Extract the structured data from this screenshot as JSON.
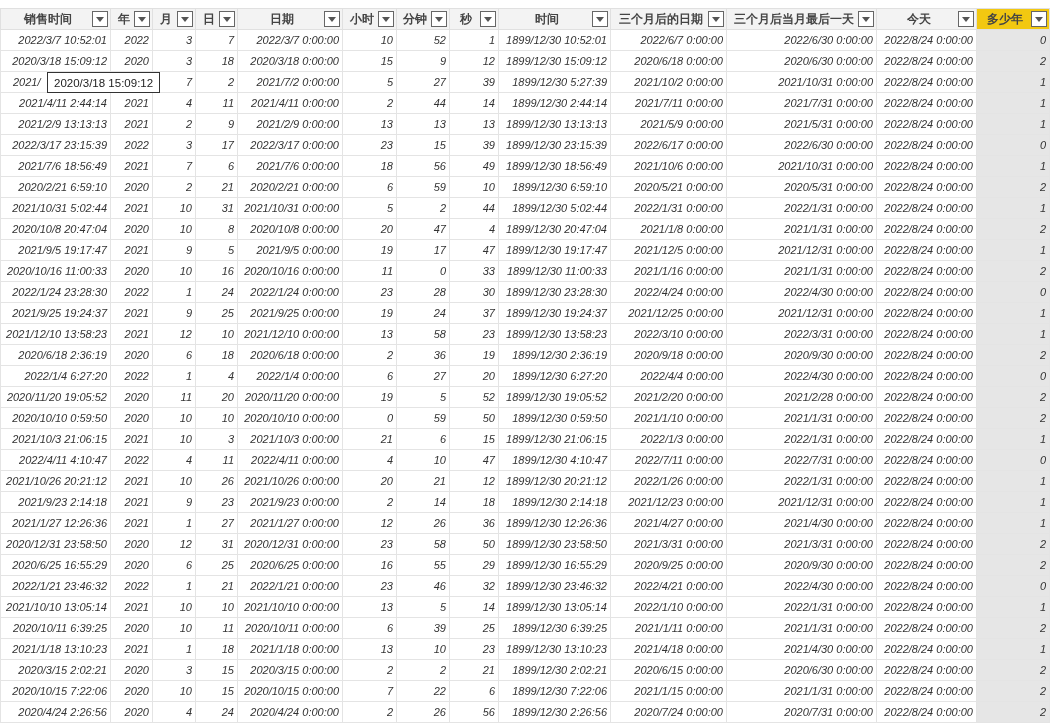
{
  "table": {
    "columns": [
      {
        "label": "销售时间",
        "selected": false
      },
      {
        "label": "年",
        "selected": false
      },
      {
        "label": "月",
        "selected": false
      },
      {
        "label": "日",
        "selected": false
      },
      {
        "label": "日期",
        "selected": false
      },
      {
        "label": "小时",
        "selected": false
      },
      {
        "label": "分钟",
        "selected": false
      },
      {
        "label": "秒",
        "selected": false
      },
      {
        "label": "时间",
        "selected": false
      },
      {
        "label": "三个月后的日期",
        "selected": false
      },
      {
        "label": "三个月后当月最后一天",
        "selected": false
      },
      {
        "label": "今天",
        "selected": false
      },
      {
        "label": "多少年",
        "selected": true
      }
    ],
    "rows": [
      [
        "2022/3/7 10:52:01",
        "2022",
        "3",
        "7",
        "2022/3/7 0:00:00",
        "10",
        "52",
        "1",
        "1899/12/30 10:52:01",
        "2022/6/7 0:00:00",
        "2022/6/30 0:00:00",
        "2022/8/24 0:00:00",
        "0"
      ],
      [
        "2020/3/18 15:09:12",
        "2020",
        "3",
        "18",
        "2020/3/18 0:00:00",
        "15",
        "9",
        "12",
        "1899/12/30 15:09:12",
        "2020/6/18 0:00:00",
        "2020/6/30 0:00:00",
        "2022/8/24 0:00:00",
        "2"
      ],
      {
        "cells": [
          "2021/",
          null,
          "7",
          "2",
          "2021/7/2 0:00:00",
          "5",
          "27",
          "39",
          "1899/12/30 5:27:39",
          "2021/10/2 0:00:00",
          "2021/10/31 0:00:00",
          "2022/8/24 0:00:00",
          "1"
        ],
        "tooltip": "2020/3/18 15:09:12"
      },
      [
        "2021/4/11 2:44:14",
        "2021",
        "4",
        "11",
        "2021/4/11 0:00:00",
        "2",
        "44",
        "14",
        "1899/12/30 2:44:14",
        "2021/7/11 0:00:00",
        "2021/7/31 0:00:00",
        "2022/8/24 0:00:00",
        "1"
      ],
      [
        "2021/2/9 13:13:13",
        "2021",
        "2",
        "9",
        "2021/2/9 0:00:00",
        "13",
        "13",
        "13",
        "1899/12/30 13:13:13",
        "2021/5/9 0:00:00",
        "2021/5/31 0:00:00",
        "2022/8/24 0:00:00",
        "1"
      ],
      [
        "2022/3/17 23:15:39",
        "2022",
        "3",
        "17",
        "2022/3/17 0:00:00",
        "23",
        "15",
        "39",
        "1899/12/30 23:15:39",
        "2022/6/17 0:00:00",
        "2022/6/30 0:00:00",
        "2022/8/24 0:00:00",
        "0"
      ],
      [
        "2021/7/6 18:56:49",
        "2021",
        "7",
        "6",
        "2021/7/6 0:00:00",
        "18",
        "56",
        "49",
        "1899/12/30 18:56:49",
        "2021/10/6 0:00:00",
        "2021/10/31 0:00:00",
        "2022/8/24 0:00:00",
        "1"
      ],
      [
        "2020/2/21 6:59:10",
        "2020",
        "2",
        "21",
        "2020/2/21 0:00:00",
        "6",
        "59",
        "10",
        "1899/12/30 6:59:10",
        "2020/5/21 0:00:00",
        "2020/5/31 0:00:00",
        "2022/8/24 0:00:00",
        "2"
      ],
      [
        "2021/10/31 5:02:44",
        "2021",
        "10",
        "31",
        "2021/10/31 0:00:00",
        "5",
        "2",
        "44",
        "1899/12/30 5:02:44",
        "2022/1/31 0:00:00",
        "2022/1/31 0:00:00",
        "2022/8/24 0:00:00",
        "1"
      ],
      [
        "2020/10/8 20:47:04",
        "2020",
        "10",
        "8",
        "2020/10/8 0:00:00",
        "20",
        "47",
        "4",
        "1899/12/30 20:47:04",
        "2021/1/8 0:00:00",
        "2021/1/31 0:00:00",
        "2022/8/24 0:00:00",
        "2"
      ],
      [
        "2021/9/5 19:17:47",
        "2021",
        "9",
        "5",
        "2021/9/5 0:00:00",
        "19",
        "17",
        "47",
        "1899/12/30 19:17:47",
        "2021/12/5 0:00:00",
        "2021/12/31 0:00:00",
        "2022/8/24 0:00:00",
        "1"
      ],
      [
        "2020/10/16 11:00:33",
        "2020",
        "10",
        "16",
        "2020/10/16 0:00:00",
        "11",
        "0",
        "33",
        "1899/12/30 11:00:33",
        "2021/1/16 0:00:00",
        "2021/1/31 0:00:00",
        "2022/8/24 0:00:00",
        "2"
      ],
      [
        "2022/1/24 23:28:30",
        "2022",
        "1",
        "24",
        "2022/1/24 0:00:00",
        "23",
        "28",
        "30",
        "1899/12/30 23:28:30",
        "2022/4/24 0:00:00",
        "2022/4/30 0:00:00",
        "2022/8/24 0:00:00",
        "0"
      ],
      [
        "2021/9/25 19:24:37",
        "2021",
        "9",
        "25",
        "2021/9/25 0:00:00",
        "19",
        "24",
        "37",
        "1899/12/30 19:24:37",
        "2021/12/25 0:00:00",
        "2021/12/31 0:00:00",
        "2022/8/24 0:00:00",
        "1"
      ],
      [
        "2021/12/10 13:58:23",
        "2021",
        "12",
        "10",
        "2021/12/10 0:00:00",
        "13",
        "58",
        "23",
        "1899/12/30 13:58:23",
        "2022/3/10 0:00:00",
        "2022/3/31 0:00:00",
        "2022/8/24 0:00:00",
        "1"
      ],
      [
        "2020/6/18 2:36:19",
        "2020",
        "6",
        "18",
        "2020/6/18 0:00:00",
        "2",
        "36",
        "19",
        "1899/12/30 2:36:19",
        "2020/9/18 0:00:00",
        "2020/9/30 0:00:00",
        "2022/8/24 0:00:00",
        "2"
      ],
      [
        "2022/1/4 6:27:20",
        "2022",
        "1",
        "4",
        "2022/1/4 0:00:00",
        "6",
        "27",
        "20",
        "1899/12/30 6:27:20",
        "2022/4/4 0:00:00",
        "2022/4/30 0:00:00",
        "2022/8/24 0:00:00",
        "0"
      ],
      [
        "2020/11/20 19:05:52",
        "2020",
        "11",
        "20",
        "2020/11/20 0:00:00",
        "19",
        "5",
        "52",
        "1899/12/30 19:05:52",
        "2021/2/20 0:00:00",
        "2021/2/28 0:00:00",
        "2022/8/24 0:00:00",
        "2"
      ],
      [
        "2020/10/10 0:59:50",
        "2020",
        "10",
        "10",
        "2020/10/10 0:00:00",
        "0",
        "59",
        "50",
        "1899/12/30 0:59:50",
        "2021/1/10 0:00:00",
        "2021/1/31 0:00:00",
        "2022/8/24 0:00:00",
        "2"
      ],
      [
        "2021/10/3 21:06:15",
        "2021",
        "10",
        "3",
        "2021/10/3 0:00:00",
        "21",
        "6",
        "15",
        "1899/12/30 21:06:15",
        "2022/1/3 0:00:00",
        "2022/1/31 0:00:00",
        "2022/8/24 0:00:00",
        "1"
      ],
      [
        "2022/4/11 4:10:47",
        "2022",
        "4",
        "11",
        "2022/4/11 0:00:00",
        "4",
        "10",
        "47",
        "1899/12/30 4:10:47",
        "2022/7/11 0:00:00",
        "2022/7/31 0:00:00",
        "2022/8/24 0:00:00",
        "0"
      ],
      [
        "2021/10/26 20:21:12",
        "2021",
        "10",
        "26",
        "2021/10/26 0:00:00",
        "20",
        "21",
        "12",
        "1899/12/30 20:21:12",
        "2022/1/26 0:00:00",
        "2022/1/31 0:00:00",
        "2022/8/24 0:00:00",
        "1"
      ],
      [
        "2021/9/23 2:14:18",
        "2021",
        "9",
        "23",
        "2021/9/23 0:00:00",
        "2",
        "14",
        "18",
        "1899/12/30 2:14:18",
        "2021/12/23 0:00:00",
        "2021/12/31 0:00:00",
        "2022/8/24 0:00:00",
        "1"
      ],
      [
        "2021/1/27 12:26:36",
        "2021",
        "1",
        "27",
        "2021/1/27 0:00:00",
        "12",
        "26",
        "36",
        "1899/12/30 12:26:36",
        "2021/4/27 0:00:00",
        "2021/4/30 0:00:00",
        "2022/8/24 0:00:00",
        "1"
      ],
      [
        "2020/12/31 23:58:50",
        "2020",
        "12",
        "31",
        "2020/12/31 0:00:00",
        "23",
        "58",
        "50",
        "1899/12/30 23:58:50",
        "2021/3/31 0:00:00",
        "2021/3/31 0:00:00",
        "2022/8/24 0:00:00",
        "2"
      ],
      [
        "2020/6/25 16:55:29",
        "2020",
        "6",
        "25",
        "2020/6/25 0:00:00",
        "16",
        "55",
        "29",
        "1899/12/30 16:55:29",
        "2020/9/25 0:00:00",
        "2020/9/30 0:00:00",
        "2022/8/24 0:00:00",
        "2"
      ],
      [
        "2022/1/21 23:46:32",
        "2022",
        "1",
        "21",
        "2022/1/21 0:00:00",
        "23",
        "46",
        "32",
        "1899/12/30 23:46:32",
        "2022/4/21 0:00:00",
        "2022/4/30 0:00:00",
        "2022/8/24 0:00:00",
        "0"
      ],
      [
        "2021/10/10 13:05:14",
        "2021",
        "10",
        "10",
        "2021/10/10 0:00:00",
        "13",
        "5",
        "14",
        "1899/12/30 13:05:14",
        "2022/1/10 0:00:00",
        "2022/1/31 0:00:00",
        "2022/8/24 0:00:00",
        "1"
      ],
      [
        "2020/10/11 6:39:25",
        "2020",
        "10",
        "11",
        "2020/10/11 0:00:00",
        "6",
        "39",
        "25",
        "1899/12/30 6:39:25",
        "2021/1/11 0:00:00",
        "2021/1/31 0:00:00",
        "2022/8/24 0:00:00",
        "2"
      ],
      [
        "2021/1/18 13:10:23",
        "2021",
        "1",
        "18",
        "2021/1/18 0:00:00",
        "13",
        "10",
        "23",
        "1899/12/30 13:10:23",
        "2021/4/18 0:00:00",
        "2021/4/30 0:00:00",
        "2022/8/24 0:00:00",
        "1"
      ],
      [
        "2020/3/15 2:02:21",
        "2020",
        "3",
        "15",
        "2020/3/15 0:00:00",
        "2",
        "2",
        "21",
        "1899/12/30 2:02:21",
        "2020/6/15 0:00:00",
        "2020/6/30 0:00:00",
        "2022/8/24 0:00:00",
        "2"
      ],
      [
        "2020/10/15 7:22:06",
        "2020",
        "10",
        "15",
        "2020/10/15 0:00:00",
        "7",
        "22",
        "6",
        "1899/12/30 7:22:06",
        "2021/1/15 0:00:00",
        "2021/1/31 0:00:00",
        "2022/8/24 0:00:00",
        "2"
      ],
      [
        "2020/4/24 2:26:56",
        "2020",
        "4",
        "24",
        "2020/4/24 0:00:00",
        "2",
        "26",
        "56",
        "1899/12/30 2:26:56",
        "2020/7/24 0:00:00",
        "2020/7/31 0:00:00",
        "2022/8/24 0:00:00",
        "2"
      ]
    ]
  }
}
